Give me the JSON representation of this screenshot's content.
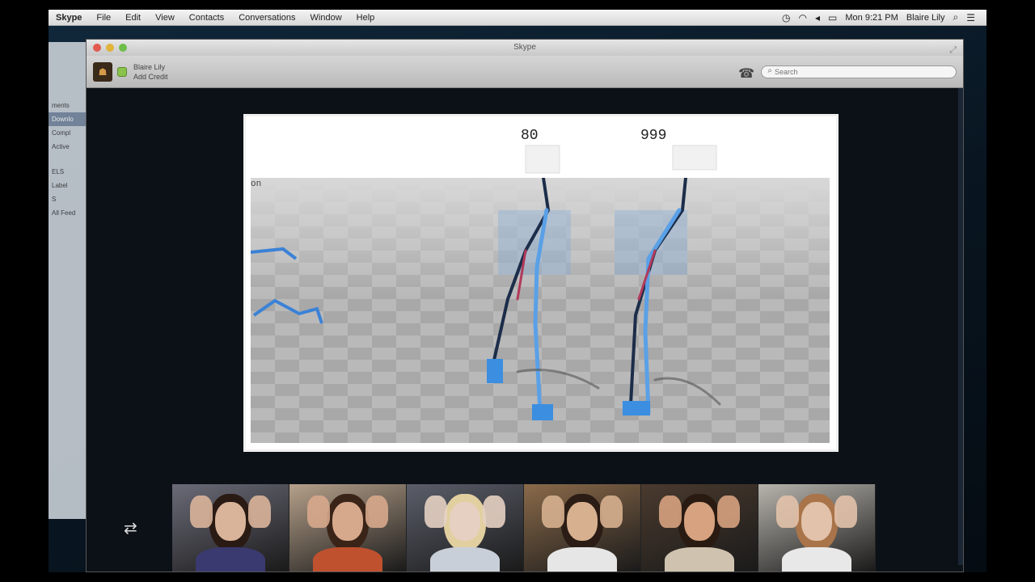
{
  "menubar": {
    "items": [
      "Skype",
      "File",
      "Edit",
      "View",
      "Contacts",
      "Conversations",
      "Window",
      "Help"
    ],
    "clock": "Mon 9:21 PM",
    "user": "Blaire Lily"
  },
  "ghost_window": {
    "items": [
      "ments",
      "Downlo",
      "Compl",
      "Active",
      "ELS",
      "Label",
      "S",
      "All Feed"
    ]
  },
  "skype": {
    "window_title": "Skype",
    "user_name": "Blaire Lily",
    "user_sub": "Add Credit",
    "search_placeholder": "Search"
  },
  "shared_screen": {
    "label": "on",
    "counter_left": "80",
    "counter_right": "999"
  },
  "participants": [
    {
      "skin": "#d9b49a",
      "hair": "#2a1a14",
      "shirt": "#3a3a70",
      "bg": "#6b6b78"
    },
    {
      "skin": "#d7a98c",
      "hair": "#3a2418",
      "shirt": "#c0512f",
      "bg": "#b5a08a"
    },
    {
      "skin": "#e6d0c2",
      "hair": "#e2cfa0",
      "shirt": "#c9cfd8",
      "bg": "#5b5e6a"
    },
    {
      "skin": "#d7b08f",
      "hair": "#2b1d15",
      "shirt": "#e6e6e6",
      "bg": "#8a6a4a"
    },
    {
      "skin": "#d6a27f",
      "hair": "#2a1b12",
      "shirt": "#cfc3b0",
      "bg": "#4a3a2e"
    },
    {
      "skin": "#e2c2aa",
      "hair": "#a9744a",
      "shirt": "#e8e8e8",
      "bg": "#b7b4ad"
    }
  ],
  "colors": {
    "accent": "#5ba3e0",
    "status_online": "#8bc34a"
  }
}
